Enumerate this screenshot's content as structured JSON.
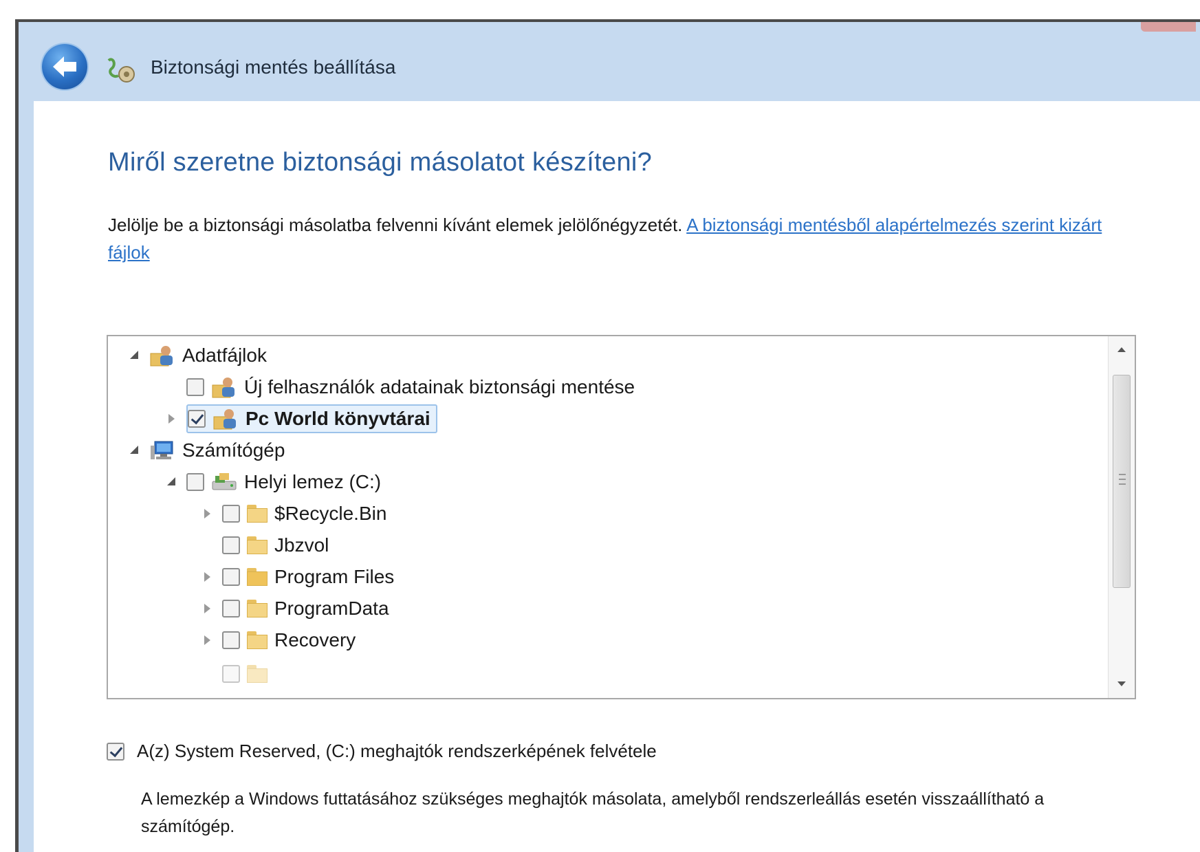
{
  "window": {
    "title": "Biztonsági mentés beállítása"
  },
  "page": {
    "heading": "Miről szeretne biztonsági másolatot készíteni?",
    "instruction_text": "Jelölje be a biztonsági másolatba felvenni kívánt elemek jelölőnégyzetét.",
    "excluded_files_link": "A biztonsági mentésből alapértelmezés szerint kizárt fájlok"
  },
  "tree": {
    "items": [
      {
        "label": "Adatfájlok",
        "checked": false
      },
      {
        "label": "Új felhasználók adatainak biztonsági mentése",
        "checked": false
      },
      {
        "label": "Pc World könyvtárai",
        "checked": true
      },
      {
        "label": "Számítógép",
        "checked": false
      },
      {
        "label": "Helyi lemez (C:)",
        "checked": false
      },
      {
        "label": "$Recycle.Bin",
        "checked": false
      },
      {
        "label": "Jbzvol",
        "checked": false
      },
      {
        "label": "Program Files",
        "checked": false
      },
      {
        "label": "ProgramData",
        "checked": false
      },
      {
        "label": "Recovery",
        "checked": false
      }
    ]
  },
  "system_image": {
    "checkbox_label": "A(z) System Reserved, (C:) meghajtók rendszerképének felvétele",
    "checked": true,
    "description": "A lemezkép a Windows futtatásához szükséges meghajtók másolata, amelyből rendszerleállás esetén visszaállítható a számítógép."
  },
  "colors": {
    "titlebar": "#c6daf0",
    "heading": "#2b5f9e",
    "link": "#2b72c8",
    "selection": "#e6f1fc"
  },
  "icons": [
    "back-arrow-icon",
    "wizard-icon",
    "user-library-icon",
    "computer-icon",
    "drive-icon",
    "folder-icon"
  ]
}
